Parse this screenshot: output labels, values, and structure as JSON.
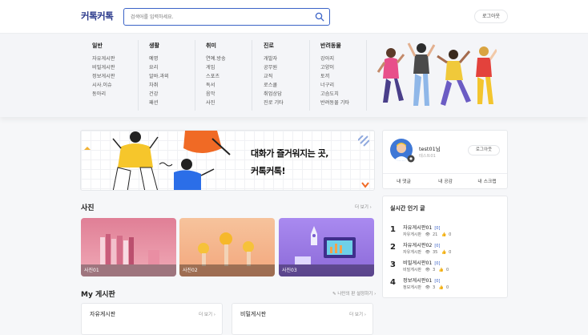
{
  "header": {
    "logo": "커톡커톡",
    "search_placeholder": "검색어를 입력하세요.",
    "logout": "로그아웃"
  },
  "menu": [
    {
      "head": "일반",
      "items": [
        "자유게시판",
        "비밀게시판",
        "정보게시판",
        "시사.이슈",
        "동아리"
      ]
    },
    {
      "head": "생활",
      "items": [
        "예명",
        "요리",
        "알바.과외",
        "차취",
        "건강",
        "패션"
      ]
    },
    {
      "head": "취미",
      "items": [
        "연예.방송",
        "게임",
        "스포츠",
        "독서",
        "음악",
        "사진"
      ]
    },
    {
      "head": "진로",
      "items": [
        "개발자",
        "공무원",
        "교직",
        "로스쿨",
        "취업상담",
        "진로 기타"
      ]
    },
    {
      "head": "반려동물",
      "items": [
        "강아지",
        "고양이",
        "토끼",
        "너구리",
        "고슴도치",
        "반려동물 기타"
      ]
    }
  ],
  "banner": {
    "line1": "대화가 즐거워지는 곳,",
    "line2": "커톡커톡!"
  },
  "photos": {
    "title": "사진",
    "more": "더 보기",
    "items": [
      {
        "caption": "사진01",
        "bg": "#e89aa6"
      },
      {
        "caption": "사진02",
        "bg": "#f3a77d"
      },
      {
        "caption": "사진03",
        "bg": "#9a7be2"
      }
    ]
  },
  "myboard": {
    "title": "My 게시판",
    "settings": "나만의 판 설정하기",
    "boards": [
      {
        "title": "자유게시판",
        "more": "더 보기"
      },
      {
        "title": "비밀게시판",
        "more": "더 보기"
      }
    ]
  },
  "profile": {
    "name": "test01님",
    "nickname": "테스트01",
    "logout": "로그아웃",
    "tabs": [
      "내 댓글",
      "내 공감",
      "내 스크랩"
    ]
  },
  "popular": {
    "title": "실시간 인기 글",
    "items": [
      {
        "rank": "1",
        "title": "자유게시판01",
        "count": "[0]",
        "board": "자유게시판",
        "views": "21",
        "likes": "0"
      },
      {
        "rank": "2",
        "title": "자유게시판02",
        "count": "[0]",
        "board": "자유게시판",
        "views": "35",
        "likes": "0"
      },
      {
        "rank": "3",
        "title": "비밀게시판01",
        "count": "[0]",
        "board": "비밀게시판",
        "views": "3",
        "likes": "0"
      },
      {
        "rank": "4",
        "title": "정보게시판01",
        "count": "[0]",
        "board": "정보게시판",
        "views": "3",
        "likes": "0"
      }
    ]
  },
  "colors": {
    "accent": "#3b63c7",
    "logo": "#2b3a8c"
  }
}
